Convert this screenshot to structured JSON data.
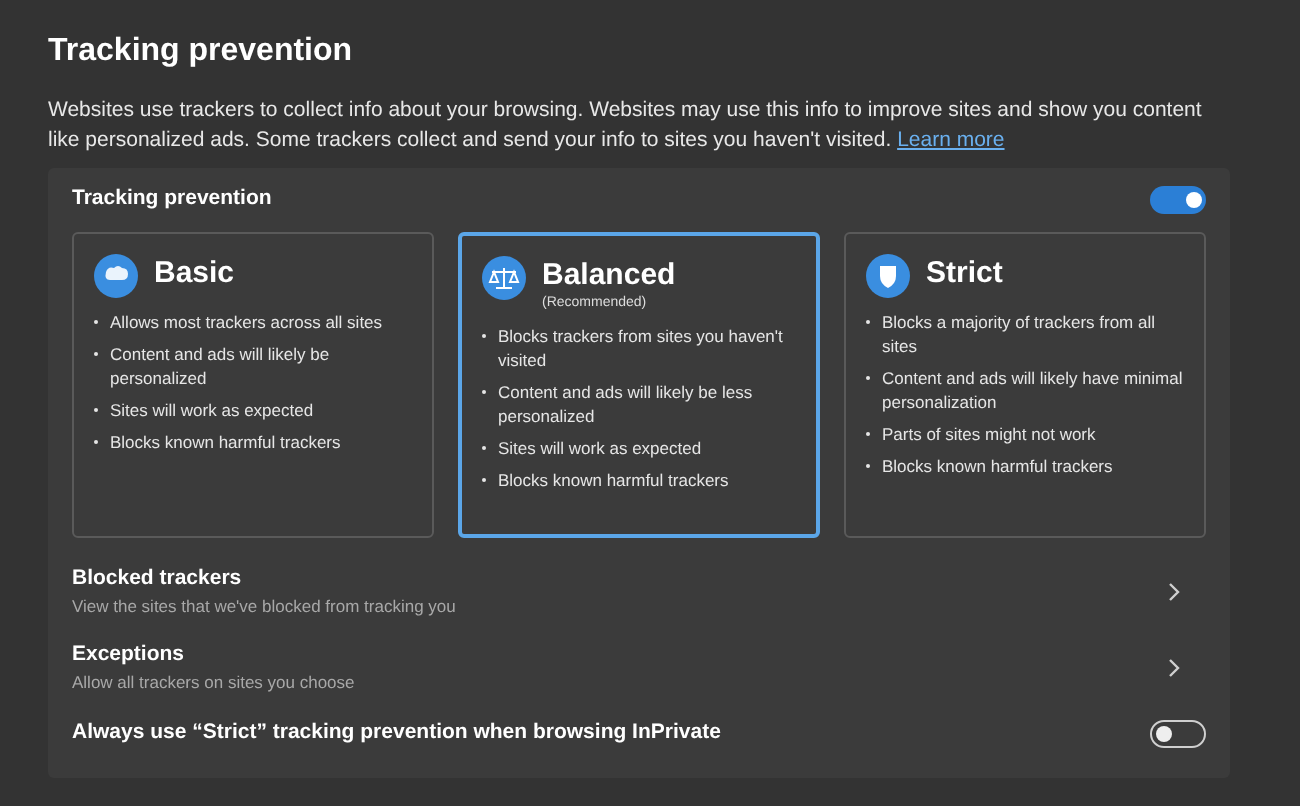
{
  "title": "Tracking prevention",
  "description": "Websites use trackers to collect info about your browsing. Websites may use this info to improve sites and show you content like personalized ads. Some trackers collect and send your info to sites you haven't visited.",
  "learn_more": "Learn more",
  "panel": {
    "label": "Tracking prevention",
    "on": true
  },
  "cards": [
    {
      "kind": "basic",
      "title": "Basic",
      "selected": false,
      "bullets": [
        "Allows most trackers across all sites",
        "Content and ads will likely be personalized",
        "Sites will work as expected",
        "Blocks known harmful trackers"
      ]
    },
    {
      "kind": "balanced",
      "title": "Balanced",
      "subtitle": "(Recommended)",
      "selected": true,
      "bullets": [
        "Blocks trackers from sites you haven't visited",
        "Content and ads will likely be less personalized",
        "Sites will work as expected",
        "Blocks known harmful trackers"
      ]
    },
    {
      "kind": "strict",
      "title": "Strict",
      "selected": false,
      "bullets": [
        "Blocks a majority of trackers from all sites",
        "Content and ads will likely have minimal personalization",
        "Parts of sites might not work",
        "Blocks known harmful trackers"
      ]
    }
  ],
  "rows": [
    {
      "kind": "link",
      "title": "Blocked trackers",
      "subtitle": "View the sites that we've blocked from tracking you"
    },
    {
      "kind": "link",
      "title": "Exceptions",
      "subtitle": "Allow all trackers on sites you choose"
    },
    {
      "kind": "toggle",
      "title": "Always use “Strict” tracking prevention when browsing InPrivate",
      "on": false
    }
  ]
}
